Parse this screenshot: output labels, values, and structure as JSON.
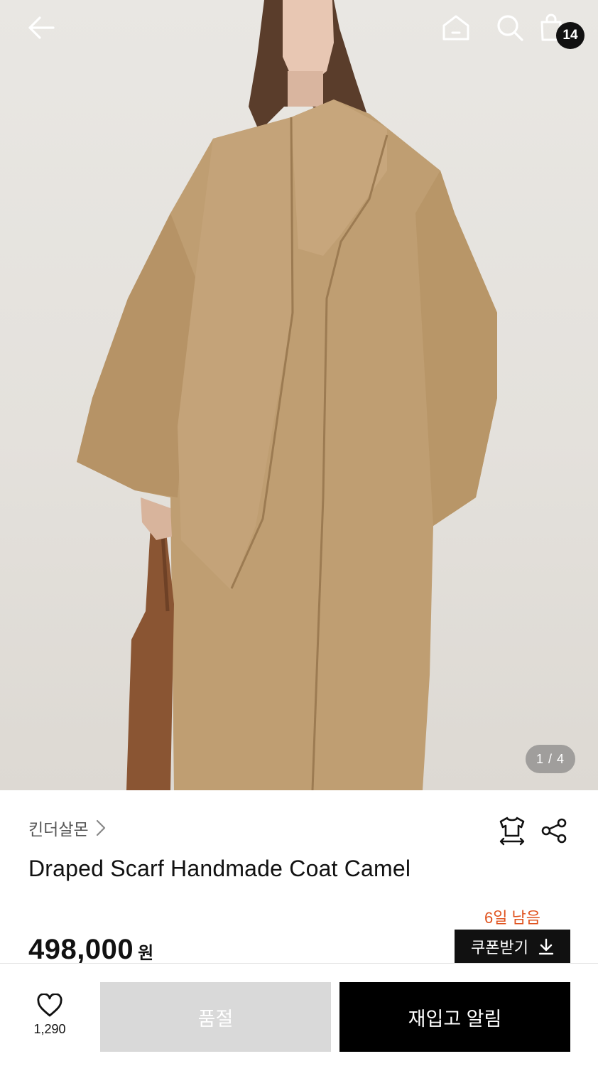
{
  "header": {
    "back_icon": "arrow-left-icon",
    "home_icon": "home-icon",
    "search_icon": "search-icon",
    "cart_icon": "shopping-bag-icon",
    "cart_count": "14"
  },
  "gallery": {
    "current": 1,
    "total": 4,
    "indicator": "1 / 4"
  },
  "product": {
    "brand": "킨더살몬",
    "title": "Draped Scarf Handmade Coat Camel",
    "price": "498,000",
    "currency": "원"
  },
  "coupon": {
    "days_left": "6일 남음",
    "button_label": "쿠폰받기",
    "icon": "download-icon",
    "accent_color": "#e0531f"
  },
  "actions": {
    "like_icon": "heart-icon",
    "like_count": "1,290",
    "soldout_label": "품절",
    "restock_label": "재입고 알림",
    "tryon_icon": "size-guide-shirt-icon",
    "share_icon": "share-icon"
  }
}
